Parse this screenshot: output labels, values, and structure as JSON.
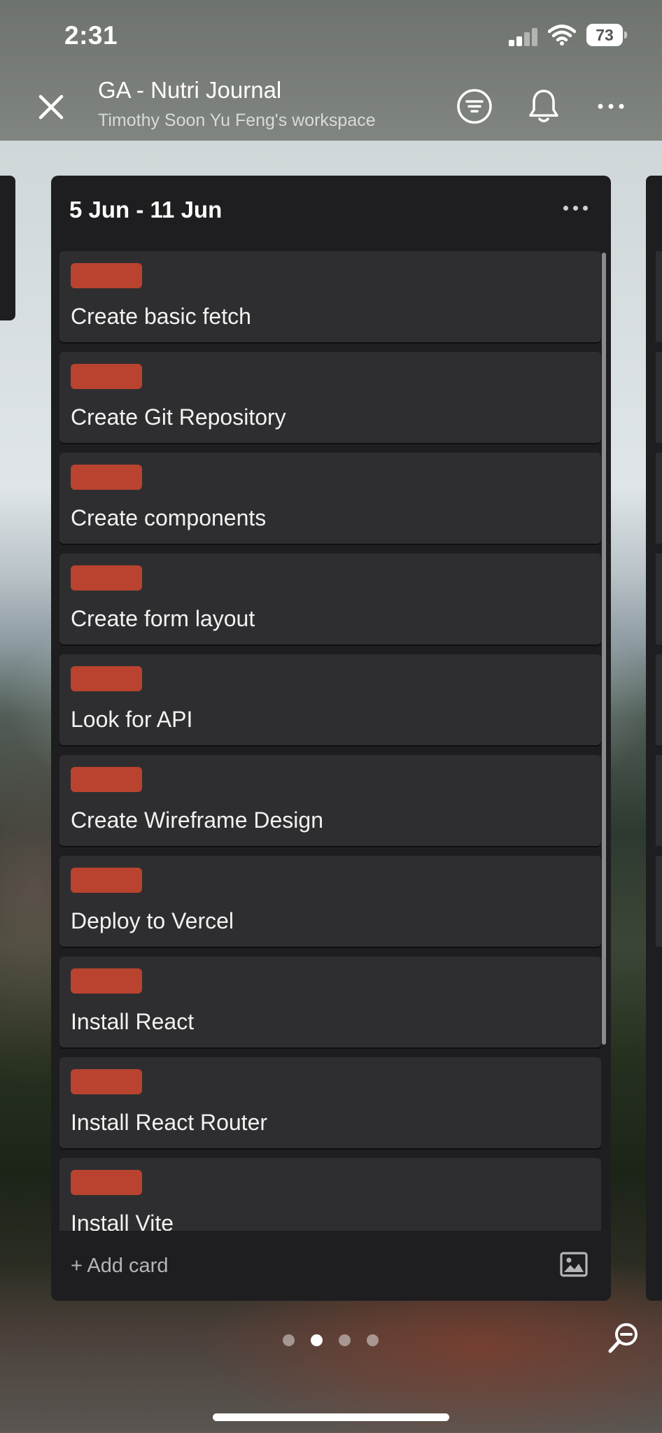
{
  "status_bar": {
    "time": "2:31",
    "battery": "73"
  },
  "header": {
    "title": "GA - Nutri Journal",
    "subtitle": "Timothy Soon Yu Feng's workspace",
    "icons": {
      "close": "close-icon",
      "filter": "filter-icon",
      "notifications": "bell-icon",
      "more": "more-horizontal-icon"
    }
  },
  "list": {
    "title": "5 Jun - 11 Jun",
    "cards": [
      {
        "title": "Create basic fetch",
        "label_color": "#b9432f"
      },
      {
        "title": "Create Git Repository",
        "label_color": "#b9432f"
      },
      {
        "title": "Create components",
        "label_color": "#b9432f"
      },
      {
        "title": "Create form layout",
        "label_color": "#b9432f"
      },
      {
        "title": "Look for API",
        "label_color": "#b9432f"
      },
      {
        "title": "Create Wireframe Design",
        "label_color": "#b9432f"
      },
      {
        "title": "Deploy to Vercel",
        "label_color": "#b9432f"
      },
      {
        "title": "Install React",
        "label_color": "#b9432f"
      },
      {
        "title": "Install React Router",
        "label_color": "#b9432f"
      },
      {
        "title": "Install Vite",
        "label_color": "#b9432f"
      }
    ],
    "add_card": "+ Add card"
  },
  "pagination": {
    "pages": 4,
    "current": 2
  },
  "colors": {
    "list_bg": "#1e1e20",
    "card_bg": "#2e2e30",
    "label_red": "#b9432f",
    "header_bg": "#767b75"
  }
}
